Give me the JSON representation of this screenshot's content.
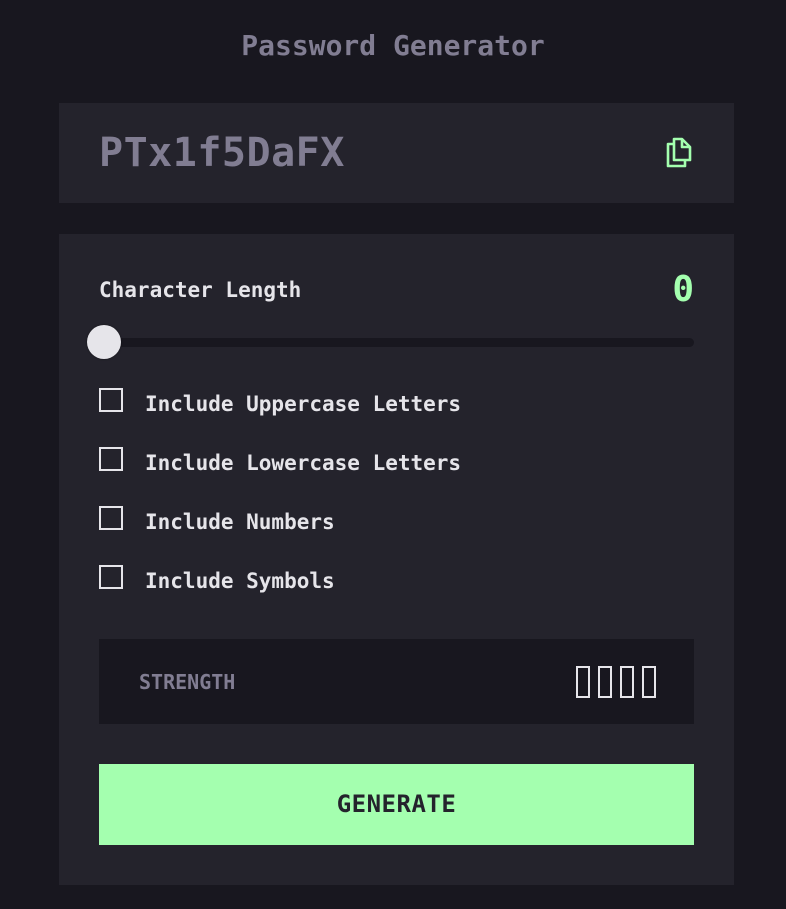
{
  "app": {
    "title": "Password Generator"
  },
  "output": {
    "password": "PTx1f5DaFX",
    "copy_icon": "copy-icon"
  },
  "length": {
    "label": "Character Length",
    "value": "0",
    "slider_fraction": 0
  },
  "options": [
    {
      "label": "Include Uppercase Letters",
      "checked": false
    },
    {
      "label": "Include Lowercase Letters",
      "checked": false
    },
    {
      "label": "Include Numbers",
      "checked": false
    },
    {
      "label": "Include Symbols",
      "checked": false
    }
  ],
  "strength": {
    "label": "STRENGTH",
    "bars_total": 4,
    "bars_filled": 0
  },
  "generate": {
    "label": "GENERATE"
  },
  "colors": {
    "background": "#18171f",
    "panel": "#24232c",
    "accent": "#a4ffaf",
    "muted_text": "#817d92",
    "text": "#e6e5ea"
  }
}
